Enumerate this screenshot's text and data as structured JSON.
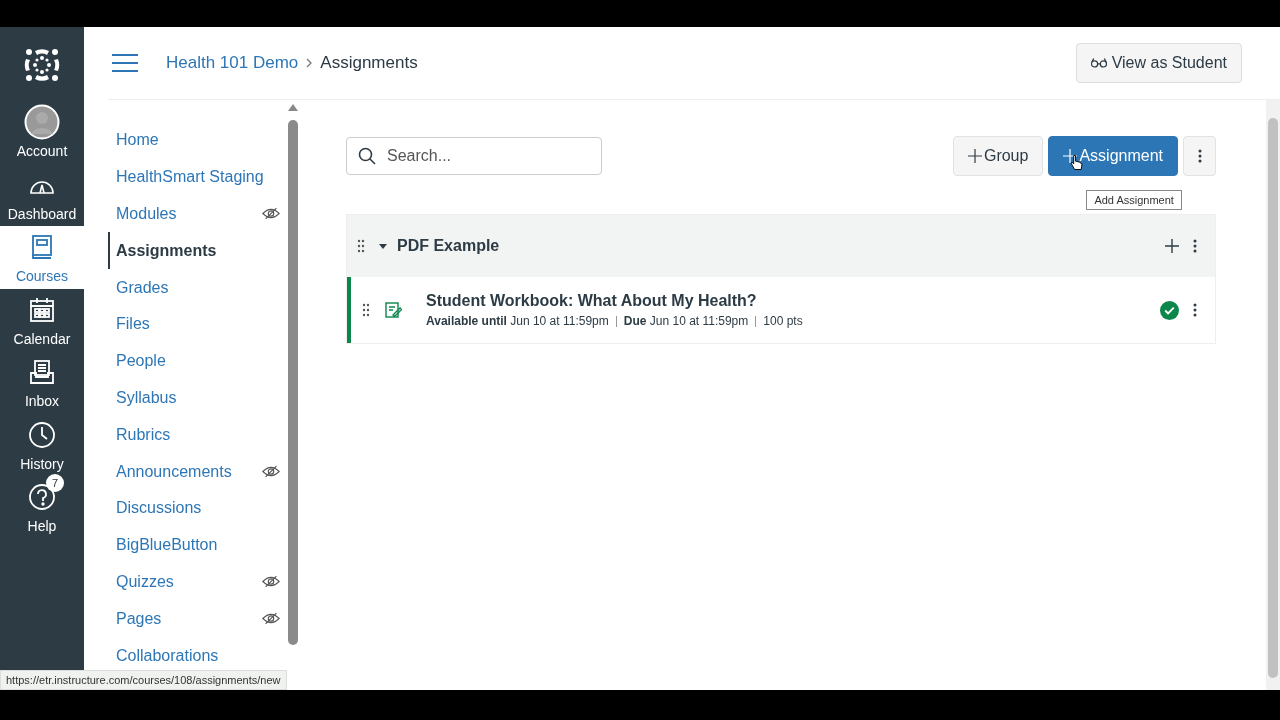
{
  "global_nav": [
    {
      "label": "Account",
      "kind": "account",
      "selected": false
    },
    {
      "label": "Dashboard",
      "kind": "dashboard",
      "selected": false
    },
    {
      "label": "Courses",
      "kind": "courses",
      "selected": true
    },
    {
      "label": "Calendar",
      "kind": "calendar",
      "selected": false
    },
    {
      "label": "Inbox",
      "kind": "inbox",
      "selected": false
    },
    {
      "label": "History",
      "kind": "history",
      "selected": false
    },
    {
      "label": "Help",
      "kind": "help",
      "selected": false,
      "badge": "7"
    }
  ],
  "breadcrumb": [
    {
      "label": "Health 101 Demo",
      "kind": "link"
    },
    {
      "label": "Assignments",
      "kind": "current"
    }
  ],
  "view_as_student": "View as Student",
  "course_nav": [
    {
      "label": "Home",
      "selected": false,
      "hidden": false
    },
    {
      "label": "HealthSmart Staging",
      "selected": false,
      "hidden": false
    },
    {
      "label": "Modules",
      "selected": false,
      "hidden": true
    },
    {
      "label": "Assignments",
      "selected": true,
      "hidden": false
    },
    {
      "label": "Grades",
      "selected": false,
      "hidden": false
    },
    {
      "label": "Files",
      "selected": false,
      "hidden": false
    },
    {
      "label": "People",
      "selected": false,
      "hidden": false
    },
    {
      "label": "Syllabus",
      "selected": false,
      "hidden": false
    },
    {
      "label": "Rubrics",
      "selected": false,
      "hidden": false
    },
    {
      "label": "Announcements",
      "selected": false,
      "hidden": true
    },
    {
      "label": "Discussions",
      "selected": false,
      "hidden": false
    },
    {
      "label": "BigBlueButton",
      "selected": false,
      "hidden": false
    },
    {
      "label": "Quizzes",
      "selected": false,
      "hidden": true
    },
    {
      "label": "Pages",
      "selected": false,
      "hidden": true
    },
    {
      "label": "Collaborations",
      "selected": false,
      "hidden": false
    }
  ],
  "search": {
    "placeholder": "Search..."
  },
  "buttons": {
    "group": "Group",
    "assignment": "Assignment",
    "tooltip": "Add Assignment"
  },
  "groups": [
    {
      "title": "PDF Example",
      "expanded": true,
      "assignments": [
        {
          "title": "Student Workbook: What About My Health?",
          "published": true,
          "meta": [
            "**Available until** Jun 10 at 11:59pm",
            "**Due** Jun 10 at 11:59pm",
            "100 pts"
          ]
        }
      ]
    }
  ],
  "status_url": "https://etr.instructure.com/courses/108/assignments/new"
}
